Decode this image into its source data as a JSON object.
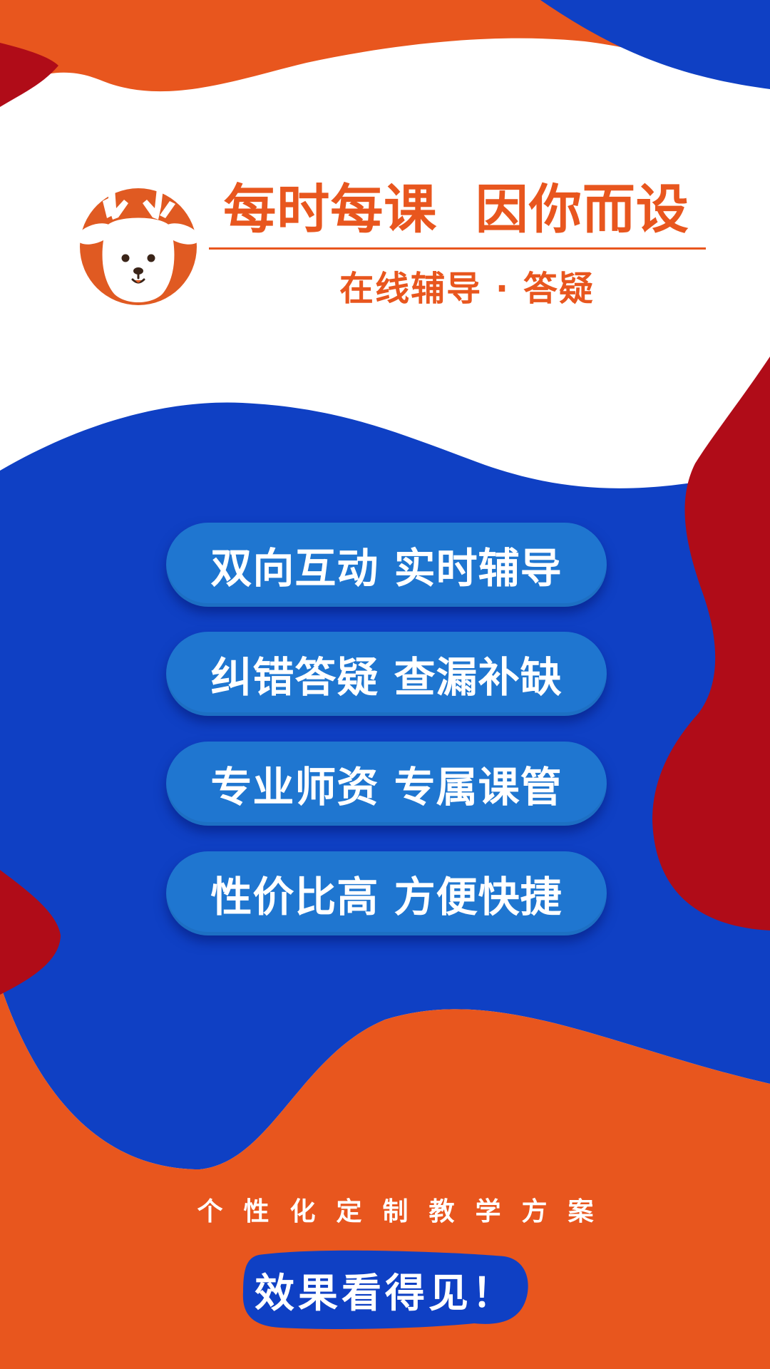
{
  "header": {
    "headline": "每时每课  因你而设",
    "subline": "在线辅导 · 答疑"
  },
  "features": [
    {
      "label": "双向互动 实时辅导"
    },
    {
      "label": "纠错答疑 查漏补缺"
    },
    {
      "label": "专业师资 专属课管"
    },
    {
      "label": "性价比高 方便快捷"
    }
  ],
  "footer": {
    "tagline": "个性化定制教学方案",
    "cta": "效果看得见！"
  },
  "colors": {
    "orange": "#E8561E",
    "blue": "#0F40C4",
    "red": "#B00C18",
    "pill": "#1F76D0",
    "white": "#FFFFFF"
  },
  "icons": {
    "logo": "deer-head-icon"
  }
}
